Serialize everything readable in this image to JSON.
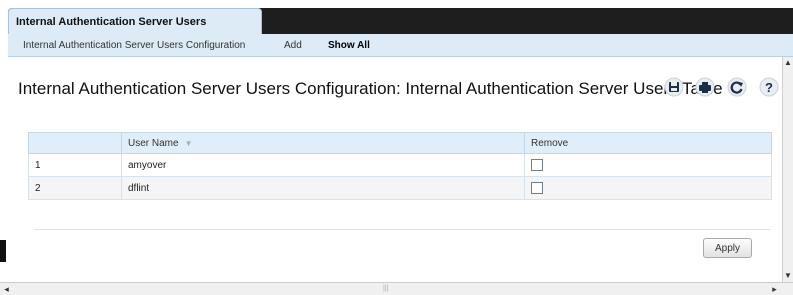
{
  "tab": {
    "label": "Internal Authentication Server Users Configuration"
  },
  "subnav": {
    "items": [
      "Internal Authentication Server Users Configuration",
      "Add",
      "Show All"
    ]
  },
  "page": {
    "title": "Internal Authentication Server Users Configuration: Internal Authentication Server Users Table"
  },
  "toolbar": {
    "icons": [
      "save-icon",
      "print-icon",
      "refresh-icon",
      "help-icon"
    ]
  },
  "table": {
    "headers": [
      "",
      "User Name",
      "Remove"
    ],
    "rows": [
      {
        "index": "1",
        "user": "amyover",
        "remove": false
      },
      {
        "index": "2",
        "user": "dflint",
        "remove": false
      }
    ]
  },
  "buttons": {
    "apply": "Apply"
  },
  "scrollbar": {
    "h_thumb_glyph": "|||"
  }
}
